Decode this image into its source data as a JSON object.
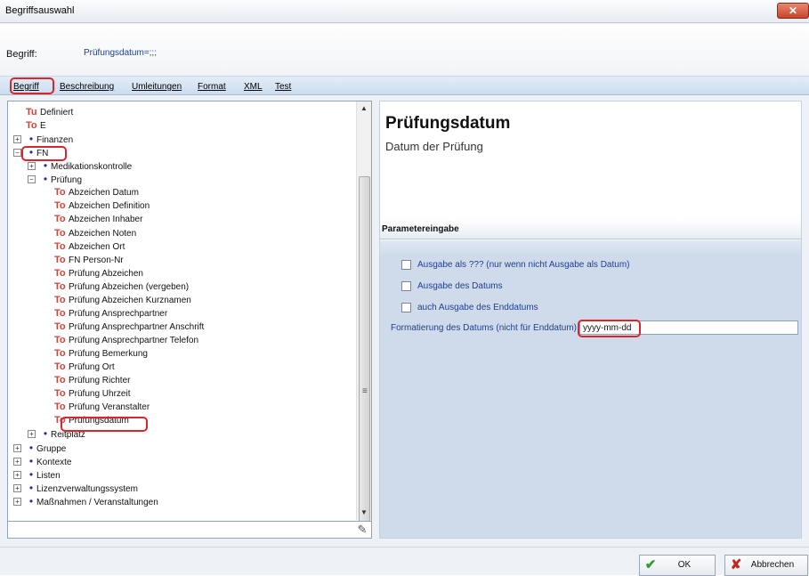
{
  "window": {
    "title": "Begriffsauswahl",
    "close_glyph": "✕"
  },
  "begriff": {
    "label": "Begriff:",
    "value": "Prüfungsdatum=;;;"
  },
  "tabs": [
    {
      "label": "Begriff"
    },
    {
      "label": "Beschreibung"
    },
    {
      "label": "Umleitungen"
    },
    {
      "label": "Format"
    },
    {
      "label": "XML"
    },
    {
      "label": "Test"
    }
  ],
  "tree": {
    "rows": [
      {
        "label": "Definiert",
        "icon": "Tu"
      },
      {
        "label": "E",
        "icon": "To"
      },
      {
        "label": "Finanzen",
        "icon": "•"
      },
      {
        "label": "FN",
        "icon": "•"
      },
      {
        "label": "Medikationskontrolle",
        "icon": "•"
      },
      {
        "label": "Prüfung",
        "icon": "•"
      },
      {
        "label": "Abzeichen Datum",
        "icon": "To"
      },
      {
        "label": "Abzeichen Definition",
        "icon": "To"
      },
      {
        "label": "Abzeichen Inhaber",
        "icon": "To"
      },
      {
        "label": "Abzeichen Noten",
        "icon": "To"
      },
      {
        "label": "Abzeichen Ort",
        "icon": "To"
      },
      {
        "label": "FN Person-Nr",
        "icon": "To"
      },
      {
        "label": "Prüfung Abzeichen",
        "icon": "To"
      },
      {
        "label": "Prüfung Abzeichen (vergeben)",
        "icon": "To"
      },
      {
        "label": "Prüfung Abzeichen Kurznamen",
        "icon": "To"
      },
      {
        "label": "Prüfung Ansprechpartner",
        "icon": "To"
      },
      {
        "label": "Prüfung Ansprechpartner Anschrift",
        "icon": "To"
      },
      {
        "label": "Prüfung Ansprechpartner Telefon",
        "icon": "To"
      },
      {
        "label": "Prüfung Bemerkung",
        "icon": "To"
      },
      {
        "label": "Prüfung Ort",
        "icon": "To"
      },
      {
        "label": "Prüfung Richter",
        "icon": "To"
      },
      {
        "label": "Prüfung Uhrzeit",
        "icon": "To"
      },
      {
        "label": "Prüfung Veranstalter",
        "icon": "To"
      },
      {
        "label": "Prüfungsdatum",
        "icon": "To"
      },
      {
        "label": "Reitplatz",
        "icon": "•"
      },
      {
        "label": "Gruppe",
        "icon": "•"
      },
      {
        "label": "Kontexte",
        "icon": "•"
      },
      {
        "label": "Listen",
        "icon": "•"
      },
      {
        "label": "Lizenzverwaltungssystem",
        "icon": "•"
      },
      {
        "label": "Maßnahmen / Veranstaltungen",
        "icon": "•"
      }
    ],
    "search_value": ""
  },
  "detail": {
    "title": "Prüfungsdatum",
    "subtitle": "Datum der Prüfung",
    "param_header": "Parametereingabe",
    "checkboxes": [
      {
        "label": "Ausgabe als ??? (nur wenn nicht Ausgabe als Datum)",
        "checked": false
      },
      {
        "label": "Ausgabe des Datums",
        "checked": false
      },
      {
        "label": "auch Ausgabe des Enddatums",
        "checked": false
      }
    ],
    "format_label": "Formatierung des Datums (nicht für Enddatum)",
    "format_value": "yyyy-mm-dd"
  },
  "buttons": {
    "ok": "OK",
    "cancel": "Abbrechen"
  },
  "colors": {
    "highlight": "#d7262c",
    "tree_term_icon": "#d0453c",
    "tree_group_bullet": "#1c2f9f",
    "ok_check": "#2f9a2f",
    "cancel_x": "#c1271f"
  }
}
